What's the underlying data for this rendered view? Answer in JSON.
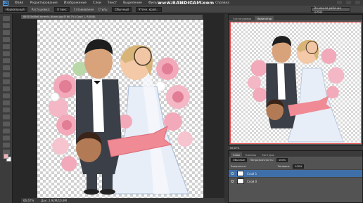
{
  "app": {
    "watermark": "www.BANDICAM.com",
    "logo": "Ps"
  },
  "menu": [
    "Файл",
    "Редактирование",
    "Изображение",
    "Слои",
    "Текст",
    "Выделение",
    "Фильтр",
    "3D",
    "Просмотр",
    "Окно",
    "Справка"
  ],
  "options": {
    "mode": "Нормальный",
    "feather_label": "Растушевка:",
    "feather_value": "0 пикс",
    "antialias": "Сглаживание",
    "style_label": "Стиль:",
    "style_value": "Обычный",
    "refine": "Уточн. край...",
    "workspace": "Основная рабочая среда"
  },
  "document": {
    "tab": "8651f5a8fa6-torrents-disney.jpg @ 66,7% (Слой 1, RGB/8)",
    "zoom": "66,67%",
    "status": "Док: 2,92M/10,9M"
  },
  "navigator": {
    "tabs": [
      "Гистограмма",
      "Навигатор"
    ],
    "zoom": "66,67%"
  },
  "layers": {
    "tabs": [
      "Слои",
      "Каналы",
      "Контуры"
    ],
    "kind": "Обычные",
    "opacity_label": "Непрозрачность:",
    "opacity_value": "100%",
    "lock_label": "Закрепить:",
    "fill_label": "Заливка:",
    "fill_value": "100%",
    "items": [
      "Слой 1",
      "Слой 0"
    ]
  },
  "colors": {
    "fg": "#f0b0b8",
    "bg": "#ffffff",
    "accent": "#e04848"
  }
}
